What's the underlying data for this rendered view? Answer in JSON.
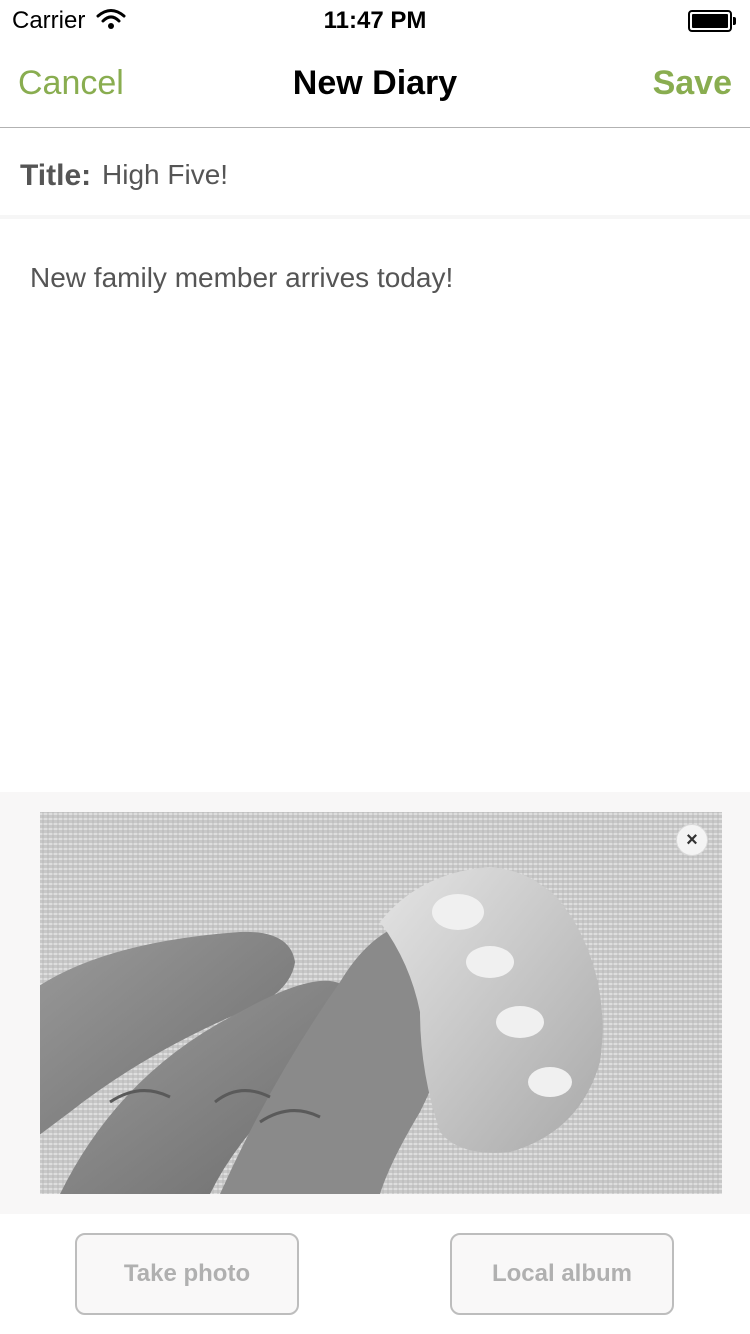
{
  "status_bar": {
    "carrier": "Carrier",
    "time": "11:47 PM",
    "wifi_icon": "wifi-icon",
    "battery_icon": "battery-icon"
  },
  "nav": {
    "cancel_label": "Cancel",
    "title": "New Diary",
    "save_label": "Save"
  },
  "form": {
    "title_label": "Title:",
    "title_value": "High Five!",
    "body_value": "New family member arrives today!"
  },
  "photo": {
    "remove_label": "×",
    "remove_icon": "close-icon"
  },
  "actions": {
    "take_photo_label": "Take photo",
    "local_album_label": "Local album"
  },
  "colors": {
    "accent": "#89ad50",
    "text_muted": "#555555",
    "button_text": "#b0b0b0"
  }
}
